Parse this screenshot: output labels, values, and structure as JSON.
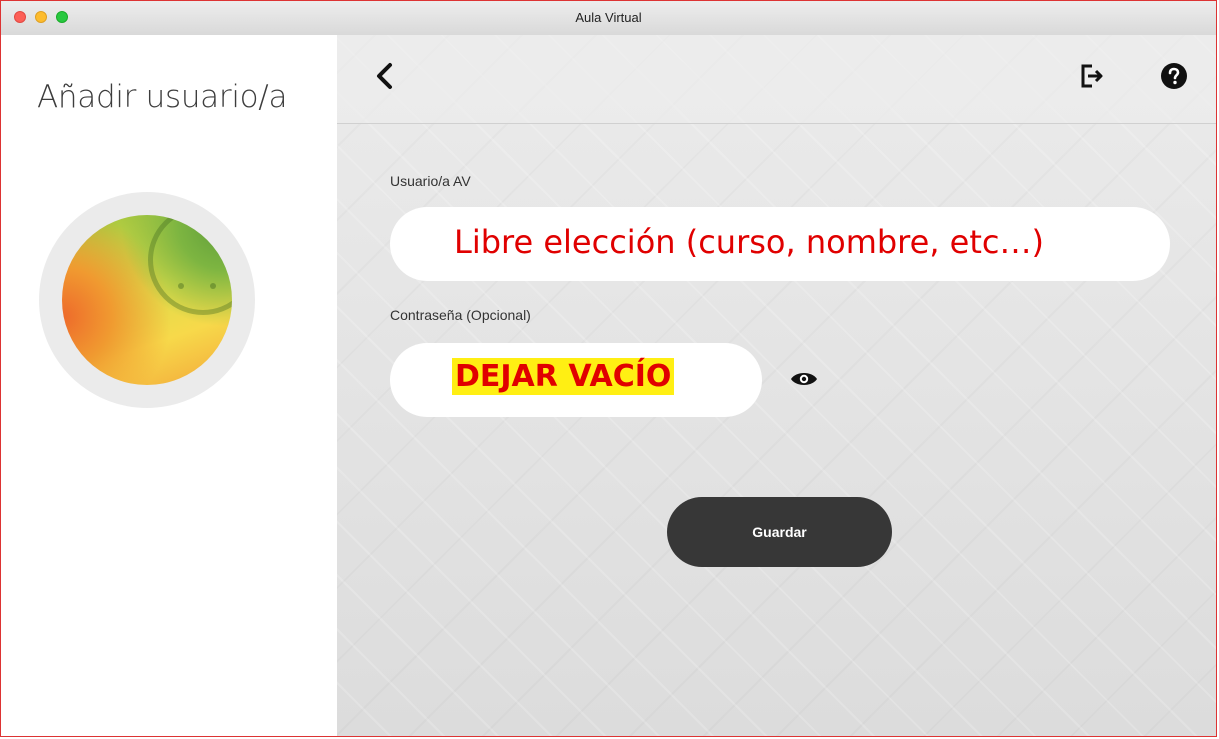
{
  "window": {
    "title": "Aula Virtual"
  },
  "sidebar": {
    "title": "Añadir usuario/a"
  },
  "form": {
    "username_label": "Usuario/a AV",
    "username_value": "Libre elección (curso, nombre, etc…)",
    "password_label": "Contraseña (Opcional)",
    "password_value": "DEJAR VACÍO",
    "save_label": "Guardar"
  },
  "icons": {
    "back": "chevron-left-icon",
    "logout": "logout-icon",
    "help": "question-circle-icon",
    "show_password": "eye-icon"
  },
  "colors": {
    "annotation_text": "#e00000",
    "annotation_highlight": "#ffef13",
    "button_bg": "#373737"
  }
}
